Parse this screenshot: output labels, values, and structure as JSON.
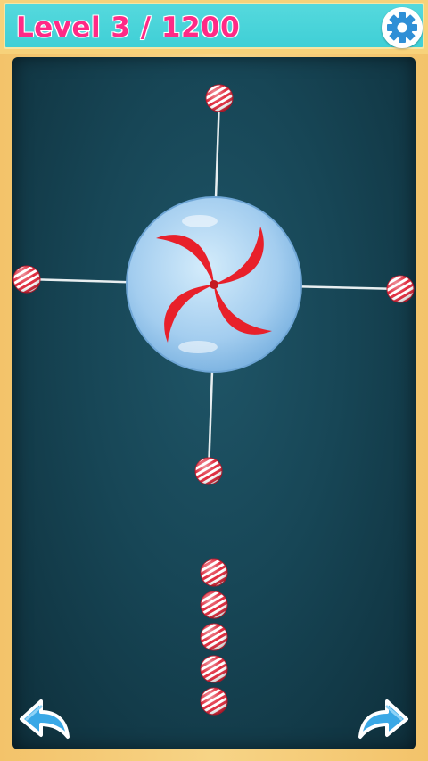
{
  "header": {
    "level_label": "Level 3 / 1200",
    "settings_icon": "gear-icon"
  },
  "game": {
    "target": "peppermint-candy-wheel",
    "pins_on_wheel": 4,
    "pins_remaining": 5
  },
  "footer": {
    "back_icon": "back-arrow-icon",
    "forward_icon": "forward-arrow-icon"
  },
  "colors": {
    "header_bg": "#45d2d8",
    "level_text": "#ff2a86",
    "board_bg": "#174656",
    "frame": "#f3c36a",
    "candy_red": "#e8202a",
    "bubble": "#a8d4f2",
    "arrow_blue": "#3aa8e6"
  }
}
